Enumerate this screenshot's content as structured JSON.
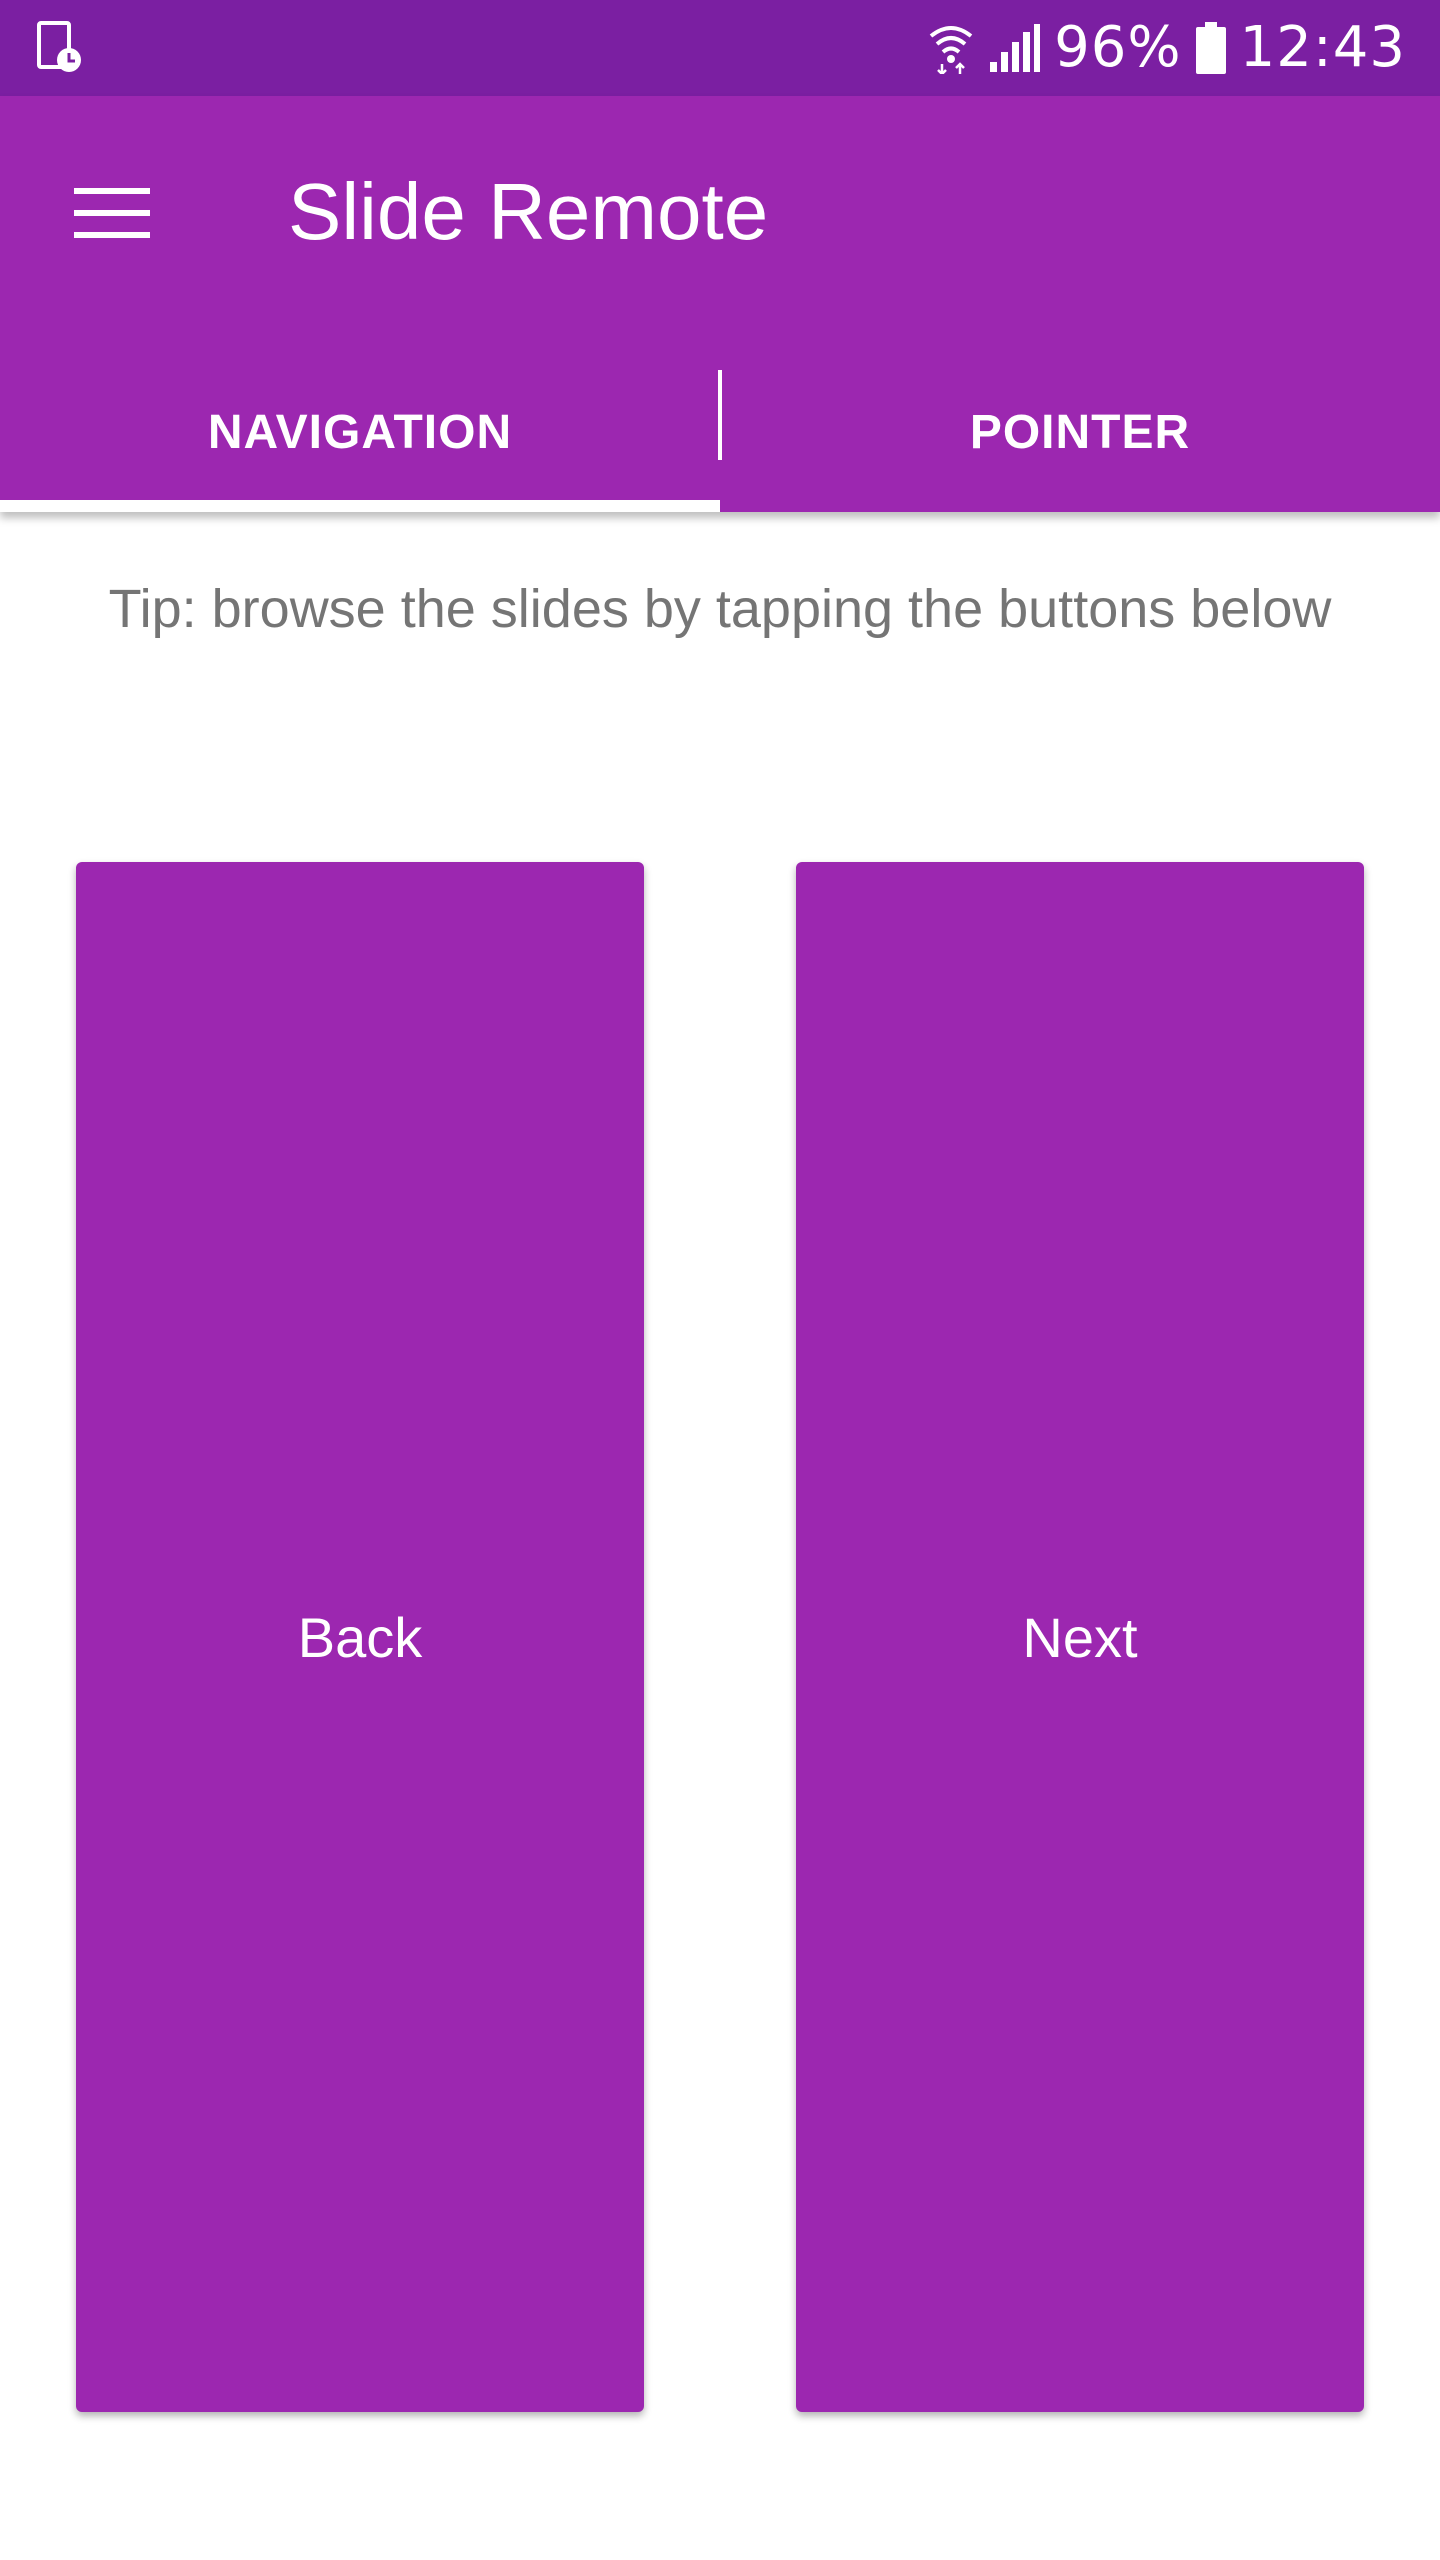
{
  "status_bar": {
    "battery_percent": "96%",
    "time": "12:43",
    "icons": [
      "screen-capture-icon",
      "wifi-icon",
      "signal-icon",
      "battery-icon"
    ]
  },
  "app_bar": {
    "title": "Slide Remote",
    "menu_icon": "hamburger-menu-icon"
  },
  "tabs": [
    {
      "label": "NAVIGATION",
      "selected": true
    },
    {
      "label": "POINTER",
      "selected": false
    }
  ],
  "tip": "Tip: browse the slides by tapping the buttons below",
  "buttons": {
    "back_label": "Back",
    "next_label": "Next"
  },
  "colors": {
    "status_bar": "#7b1fa2",
    "primary": "#9c27b0",
    "tip_text": "#757575",
    "on_primary": "#ffffff"
  }
}
